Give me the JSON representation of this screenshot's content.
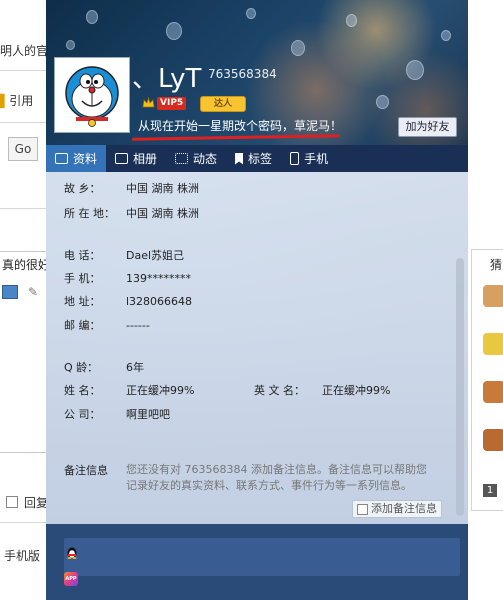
{
  "background": {
    "text_top": "明人的官",
    "quote_label": "引用",
    "go_button": "Go",
    "text_middle": "真的很好",
    "reply_label": "回复",
    "mobile_label": "手机版",
    "right_tab": "猜",
    "right_num": "1"
  },
  "profile": {
    "nickname": "、LyT",
    "qq_number": "763568384",
    "vip_label": "VIP5",
    "daren_label": "达人",
    "signature": "从现在开始一星期改个密码，草泥马！",
    "add_friend_button": "加为好友"
  },
  "tabs": [
    {
      "label": "资料",
      "icon": "profile-card-icon",
      "active": true
    },
    {
      "label": "相册",
      "icon": "photo-album-icon",
      "active": false
    },
    {
      "label": "动态",
      "icon": "feed-grid-icon",
      "active": false
    },
    {
      "label": "标签",
      "icon": "bookmark-icon",
      "active": false
    },
    {
      "label": "手机",
      "icon": "mobile-phone-icon",
      "active": false
    }
  ],
  "info": {
    "hometown": {
      "label": "故    乡：",
      "value": "中国 湖南 株洲"
    },
    "location": {
      "label": "所 在 地：",
      "value": "中国 湖南 株洲"
    },
    "phone": {
      "label": "电    话：",
      "value": "Dael苏姐己"
    },
    "mobile": {
      "label": "手    机：",
      "value": "139********"
    },
    "address": {
      "label": "地    址：",
      "value": "l328066648"
    },
    "postcode": {
      "label": "邮    编：",
      "value": "------"
    },
    "qage": {
      "label": "Q    龄：",
      "value": "6年"
    },
    "name": {
      "label": "姓    名：",
      "value": "正在缓冲99%"
    },
    "english_name": {
      "label": "英 文 名：",
      "value": "正在缓冲99%"
    },
    "company": {
      "label": "公    司：",
      "value": "啊里吧吧"
    }
  },
  "notes": {
    "label": "备注信息",
    "text": "您还没有对 763568384 添加备注信息。备注信息可以帮助您记录好友的真实资料、联系方式、事件行为等一系列信息。",
    "button": "添加备注信息"
  },
  "footer": {
    "app_label": "APP"
  }
}
